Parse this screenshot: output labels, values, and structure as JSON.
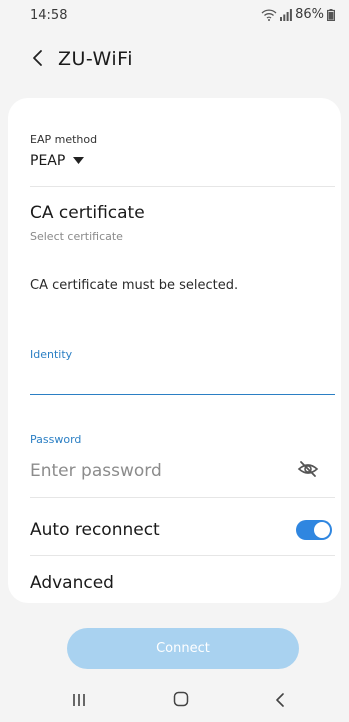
{
  "status_bar": {
    "time": "14:58",
    "battery": "86%"
  },
  "header": {
    "title": "ZU-WiFi"
  },
  "form": {
    "eap_method_label": "EAP method",
    "eap_method_value": "PEAP",
    "ca_certificate_title": "CA certificate",
    "ca_certificate_subtitle": "Select certificate",
    "ca_warning": "CA certificate must be selected.",
    "identity_label": "Identity",
    "identity_value": "",
    "password_label": "Password",
    "password_placeholder": "Enter password",
    "auto_reconnect_label": "Auto reconnect",
    "auto_reconnect_on": true,
    "advanced_label": "Advanced"
  },
  "connect_button_label": "Connect",
  "colors": {
    "accent": "#2f86e0",
    "label_blue": "#2b7fc4",
    "connect_disabled": "#a9d2f0",
    "background": "#f4f4f4"
  },
  "icons": [
    "wifi-icon",
    "signal-icon",
    "battery-icon",
    "back-arrow-icon",
    "dropdown-triangle-icon",
    "eye-off-icon",
    "recent-apps-icon",
    "home-icon",
    "nav-back-icon"
  ]
}
